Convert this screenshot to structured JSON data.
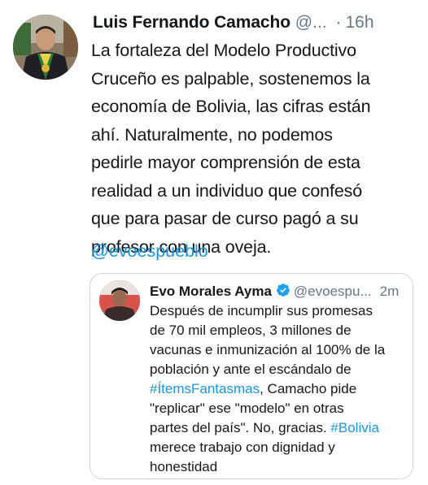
{
  "tweet": {
    "author_name": "Luis Fernando Camacho",
    "author_handle": "@...",
    "separator": "·",
    "time": "16h",
    "text_lines": [
      "La fortaleza del Modelo Productivo",
      "Cruceño es palpable, sostenemos la",
      "economía de Bolivia, las cifras están",
      "ahí. Naturalmente, no podemos",
      "pedirle mayor comprensión de esta",
      "realidad a un individuo que confesó",
      "que para pasar de curso pagó a su",
      "profesor con una oveja."
    ],
    "mention": "@evoespueblo",
    "avatar_icon": "profile-photo"
  },
  "quoted_tweet": {
    "author_name": "Evo Morales Ayma",
    "verified_icon": "verified-badge-icon",
    "author_handle": "@evoespu...",
    "time": "2m",
    "text_lines": [
      "Después de incumplir sus promesas",
      "de 70 mil empleos, 3 millones de",
      "vacunas e inmunización al 100% de la",
      "población y ante el escándalo de"
    ],
    "hashtag_1": "#ÍtemsFantasmas",
    "line5_rest": ", Camacho pide",
    "line6": "\"replicar\" ese \"modelo\" en otras",
    "line7_start": "partes del país\". No, gracias. ",
    "hashtag_2": "#Bolivia",
    "line8": "merece trabajo con dignidad y",
    "line9": "honestidad",
    "avatar_icon": "profile-photo"
  },
  "colors": {
    "text": "#14171a",
    "secondary": "#657786",
    "link": "#1b95e0",
    "border": "#ccd6dd"
  }
}
